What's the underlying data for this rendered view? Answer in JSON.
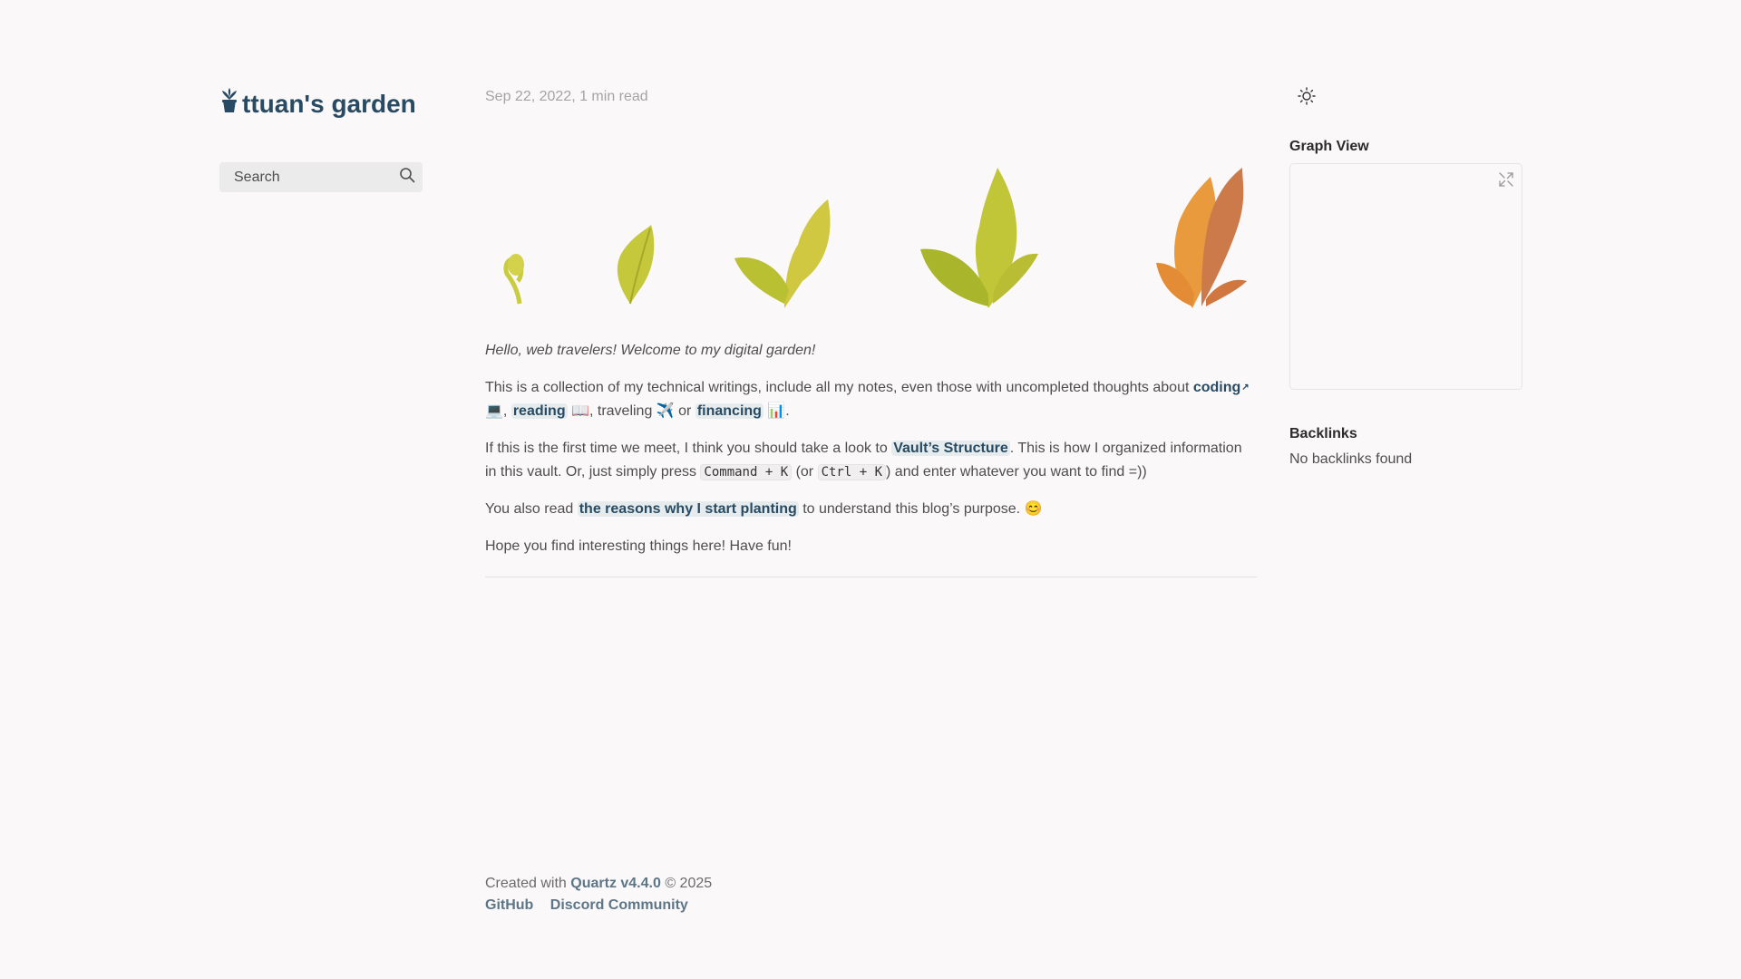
{
  "site": {
    "title": "ttuan's garden"
  },
  "search": {
    "placeholder": "Search"
  },
  "article": {
    "meta": "Sep 22, 2022,  1 min read",
    "intro": "Hello, web travelers! Welcome to my digital garden!",
    "p1": {
      "before": "This is a collection of my technical writings, include all my notes, even those with uncompleted thoughts about ",
      "coding": "coding",
      "after_coding": " 💻, ",
      "reading": "reading",
      "after_reading": " 📖, traveling ✈️ or ",
      "financing": "financing",
      "end": " 📊."
    },
    "p2": {
      "before": "If this is the first time we meet, I think you should take a look to ",
      "vault": "Vault’s Structure",
      "mid": ". This is how I organized information in this vault. Or, just simply press ",
      "cmd": "Command + K",
      "or": " (or ",
      "ctrl": "Ctrl + K",
      "end": ") and enter whatever you want to find =))"
    },
    "p3": {
      "before": "You also read ",
      "link": "the reasons why I start planting",
      "end": " to understand this blog’s purpose. 😊"
    },
    "p4": "Hope you find interesting things here! Have fun!"
  },
  "footer": {
    "created_with": "Created with ",
    "quartz": "Quartz v4.4.0",
    "copyright": " © 2025",
    "links": [
      "GitHub",
      "Discord Community"
    ]
  },
  "sidebar_right": {
    "graph_title": "Graph View",
    "backlinks_title": "Backlinks",
    "backlinks_empty": "No backlinks found"
  },
  "icons": {
    "logo": "potted-plant-icon",
    "search": "search-icon",
    "theme": "sun-icon",
    "expand": "expand-icon"
  },
  "colors": {
    "accent": "#284b63",
    "background": "#faf8f8",
    "text": "#4e4e4e"
  }
}
